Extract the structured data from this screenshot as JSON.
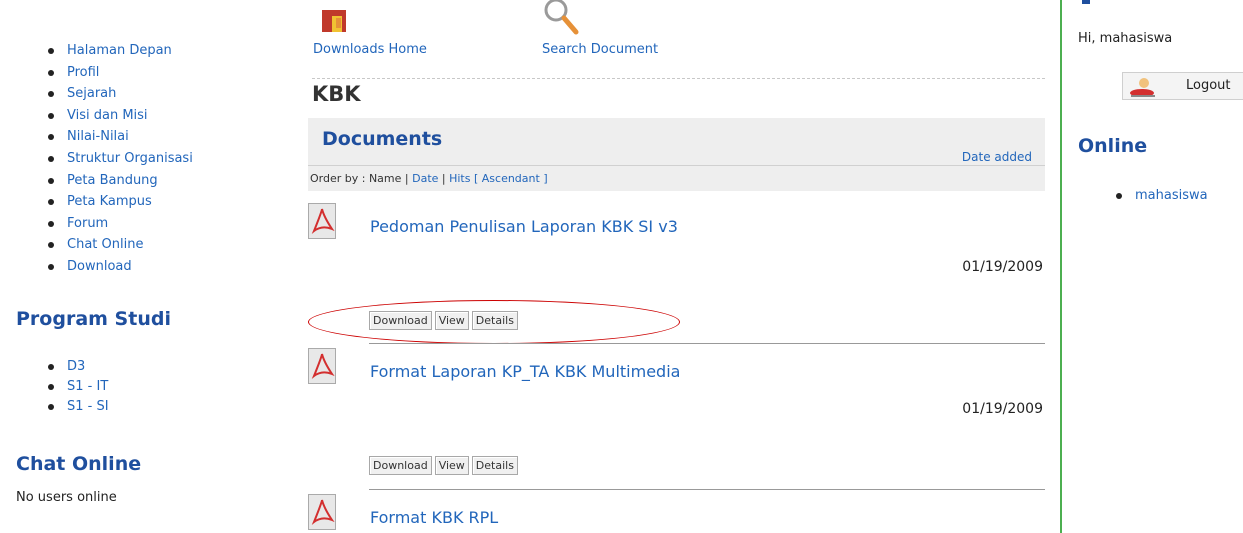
{
  "left_nav": {
    "items": [
      "Halaman Depan",
      "Profil",
      "Sejarah",
      "Visi dan Misi",
      "Nilai-Nilai",
      "Struktur Organisasi",
      "Peta Bandung",
      "Peta Kampus",
      "Forum",
      "Chat Online",
      "Download"
    ]
  },
  "program_studi": {
    "heading": "Program Studi",
    "items": [
      "D3",
      "S1 - IT",
      "S1 - SI"
    ]
  },
  "chat_online": {
    "heading": "Chat Online",
    "status": "No users online"
  },
  "top_links": {
    "downloads_home": "Downloads Home",
    "search_document": "Search Document"
  },
  "category_title": "KBK",
  "documents": {
    "heading": "Documents",
    "date_added": "Date added",
    "order_prefix": "Order by : Name | ",
    "order_date": "Date",
    "order_sep": " | ",
    "order_hits": "Hits [ Ascendant ]",
    "items": [
      {
        "title": "Pedoman Penulisan Laporan KBK SI v3",
        "date": "01/19/2009"
      },
      {
        "title": "Format Laporan KP_TA KBK Multimedia",
        "date": "01/19/2009"
      },
      {
        "title": "Format KBK RPL",
        "date": ""
      }
    ],
    "buttons": {
      "download": "Download",
      "view": "View",
      "details": "Details"
    }
  },
  "right": {
    "greeting": "Hi, mahasiswa",
    "logout": "Logout",
    "online_heading": "Online",
    "online_users": [
      "mahasiswa"
    ]
  },
  "colors": {
    "heading": "#1f4f9e",
    "link": "#2266bb",
    "highlight": "#cc0000",
    "sidebar_border": "#4caf50"
  }
}
